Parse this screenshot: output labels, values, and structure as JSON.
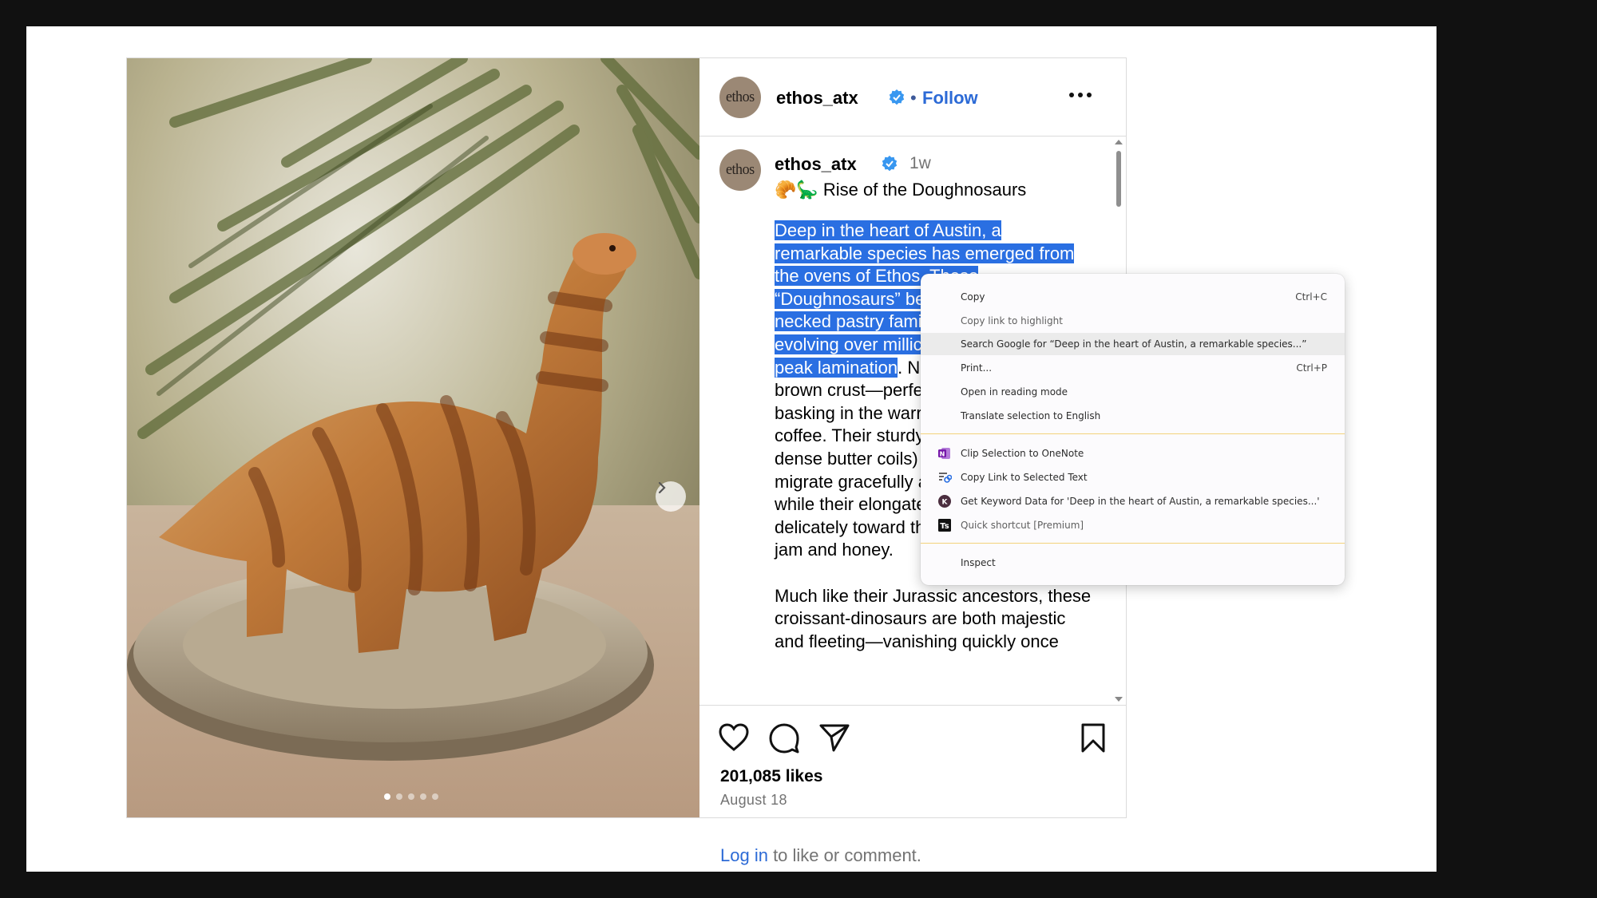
{
  "post": {
    "username": "ethos_atx",
    "avatar_text": "ethos",
    "follow_label": "Follow",
    "dot_separator": "•",
    "caption_user": "ethos_atx",
    "caption_time": "1w",
    "caption_title": "🥐🦕 Rise of the Doughnosaurs",
    "paragraph1_selected": "Deep in the heart of Austin, a remarkable species has emerged from the ovens of Ethos. These “Doughnosaurs” be necked pastry fami evolving over millic peak lamination",
    "paragraph1_lines_selected": [
      "Deep in the heart of Austin, a",
      "remarkable species has emerged from",
      "the ovens of Ethos. These",
      "“Doughnosaurs” be",
      "necked pastry fami",
      "evolving over millic",
      "peak lamination"
    ],
    "paragraph1_rest_first": ". N",
    "paragraph1_lines_rest": [
      "brown crust—perfe",
      "basking in the warr",
      "coffee. Their sturdy",
      "dense butter coils)",
      "migrate gracefully a",
      "while their elongate",
      "delicately toward th",
      "jam and honey."
    ],
    "paragraph2_lines": [
      "Much like their Jurassic ancestors, these",
      "croissant-dinosaurs are both majestic",
      "and fleeting—vanishing quickly once"
    ],
    "likes": "201,085 likes",
    "date": "August 18",
    "login_link": "Log in",
    "login_rest": " to like or comment.",
    "carousel_count": 5,
    "carousel_active": 1
  },
  "context_menu": {
    "items": [
      {
        "label": "Copy",
        "shortcut": "Ctrl+C"
      },
      {
        "label": "Copy link to highlight",
        "shortcut": ""
      },
      {
        "label": "Search Google for “Deep in the heart of Austin, a remarkable species...”",
        "shortcut": ""
      },
      {
        "label": "Print...",
        "shortcut": "Ctrl+P"
      },
      {
        "label": "Open in reading mode",
        "shortcut": ""
      },
      {
        "label": "Translate selection to English",
        "shortcut": ""
      },
      {
        "label": "Clip Selection to OneNote",
        "shortcut": "",
        "icon": "onenote-icon"
      },
      {
        "label": "Copy Link to Selected Text",
        "shortcut": "",
        "icon": "link-text-icon"
      },
      {
        "label": "Get Keyword Data for 'Deep in the heart of Austin, a remarkable species...'",
        "shortcut": "",
        "icon": "keyword-icon"
      },
      {
        "label": "Quick shortcut [Premium]",
        "shortcut": "",
        "icon": "text-shortcut-icon"
      },
      {
        "label": "Inspect",
        "shortcut": ""
      }
    ]
  },
  "colors": {
    "link_blue": "#2c6ad6",
    "selection": "#2a6fe2",
    "menu_separator": "#f3d27a",
    "verified": "#3897f0"
  }
}
